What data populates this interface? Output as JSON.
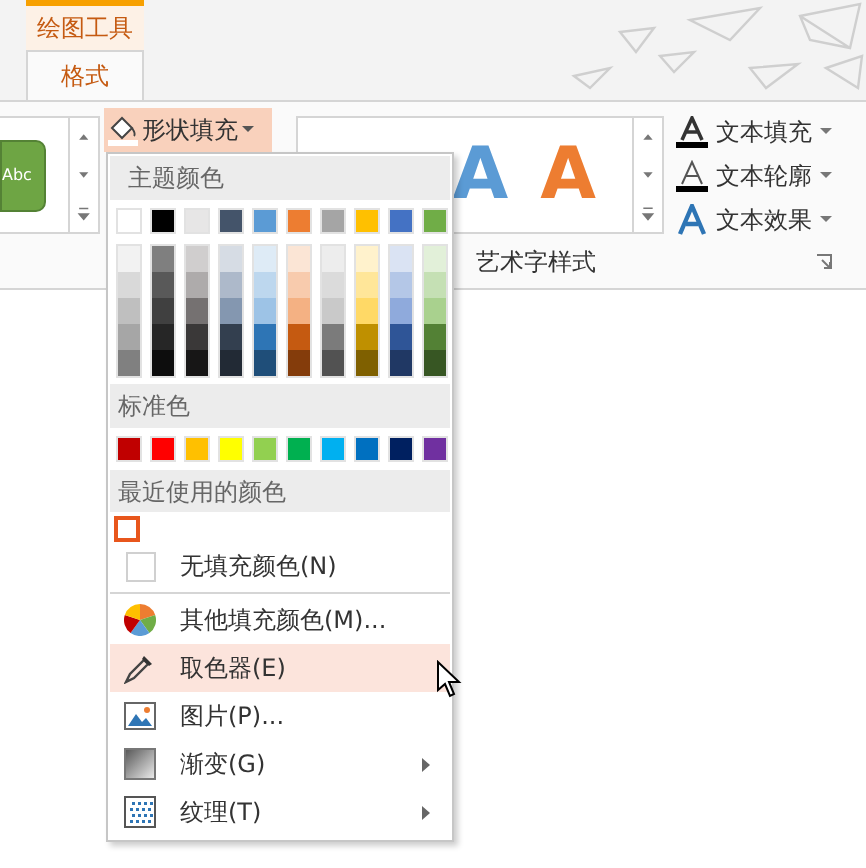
{
  "context_tab": {
    "label": "绘图工具"
  },
  "tabs": [
    {
      "label": "格式",
      "selected": true
    }
  ],
  "ribbon": {
    "shape_gallery": {
      "sample": "Abc"
    },
    "fill_button": {
      "label": "形状填充",
      "expanded": true
    },
    "wordart_gallery": {
      "samples": [
        {
          "text": "A",
          "color": "#5b9bd5"
        },
        {
          "text": "A",
          "color": "#ed7d31"
        }
      ]
    },
    "text_buttons": [
      {
        "kind": "fill",
        "label": "文本填充"
      },
      {
        "kind": "outline",
        "label": "文本轮廓"
      },
      {
        "kind": "effect",
        "label": "文本效果"
      }
    ],
    "group_label": "艺术字样式"
  },
  "menu": {
    "theme_header": "主题颜色",
    "theme_colors": [
      {
        "color": "#ffffff"
      },
      {
        "color": "#000000"
      },
      {
        "color": "#e7e6e6"
      },
      {
        "color": "#44546a"
      },
      {
        "color": "#5b9bd5"
      },
      {
        "color": "#ed7d31"
      },
      {
        "color": "#a5a5a5"
      },
      {
        "color": "#ffc000"
      },
      {
        "color": "#4472c4"
      },
      {
        "color": "#70ad47"
      }
    ],
    "shade_columns": [
      {
        "shades": [
          {
            "color": "#f2f2f2"
          },
          {
            "color": "#d9d9d9"
          },
          {
            "color": "#bfbfbf"
          },
          {
            "color": "#a6a6a6"
          },
          {
            "color": "#808080"
          }
        ]
      },
      {
        "shades": [
          {
            "color": "#7f7f7f"
          },
          {
            "color": "#595959"
          },
          {
            "color": "#404040"
          },
          {
            "color": "#262626"
          },
          {
            "color": "#0d0d0d"
          }
        ]
      },
      {
        "shades": [
          {
            "color": "#d0cece"
          },
          {
            "color": "#aeabab"
          },
          {
            "color": "#757171"
          },
          {
            "color": "#3a3838"
          },
          {
            "color": "#171616"
          }
        ]
      },
      {
        "shades": [
          {
            "color": "#d6dce4"
          },
          {
            "color": "#adb9ca"
          },
          {
            "color": "#8497b0"
          },
          {
            "color": "#333f4f"
          },
          {
            "color": "#222a35"
          }
        ]
      },
      {
        "shades": [
          {
            "color": "#deebf6"
          },
          {
            "color": "#bdd7ee"
          },
          {
            "color": "#9dc3e6"
          },
          {
            "color": "#2e75b5"
          },
          {
            "color": "#1f4e79"
          }
        ]
      },
      {
        "shades": [
          {
            "color": "#fbe5d5"
          },
          {
            "color": "#f8cbad"
          },
          {
            "color": "#f4b183"
          },
          {
            "color": "#c55a11"
          },
          {
            "color": "#843c0b"
          }
        ]
      },
      {
        "shades": [
          {
            "color": "#ededed"
          },
          {
            "color": "#dbdbdb"
          },
          {
            "color": "#c9c9c9"
          },
          {
            "color": "#7b7b7b"
          },
          {
            "color": "#525252"
          }
        ]
      },
      {
        "shades": [
          {
            "color": "#fff2cc"
          },
          {
            "color": "#ffe699"
          },
          {
            "color": "#ffd966"
          },
          {
            "color": "#bf9000"
          },
          {
            "color": "#7f6000"
          }
        ]
      },
      {
        "shades": [
          {
            "color": "#dae3f3"
          },
          {
            "color": "#b4c7e7"
          },
          {
            "color": "#8faadc"
          },
          {
            "color": "#2f5597"
          },
          {
            "color": "#203864"
          }
        ]
      },
      {
        "shades": [
          {
            "color": "#e2f0d9"
          },
          {
            "color": "#c5e0b4"
          },
          {
            "color": "#a9d18e"
          },
          {
            "color": "#538135"
          },
          {
            "color": "#375623"
          }
        ]
      }
    ],
    "standard_header": "标准色",
    "standard_colors": [
      {
        "color": "#c00000"
      },
      {
        "color": "#ff0000"
      },
      {
        "color": "#ffc000"
      },
      {
        "color": "#ffff00"
      },
      {
        "color": "#92d050"
      },
      {
        "color": "#00b050"
      },
      {
        "color": "#00b0f0"
      },
      {
        "color": "#0070c0"
      },
      {
        "color": "#002060"
      },
      {
        "color": "#7030a0"
      }
    ],
    "recent_header": "最近使用的颜色",
    "recent_colors": [
      {
        "selected": true
      }
    ],
    "items": [
      {
        "kind": "no-fill",
        "label": "无填充颜色(N)",
        "selected": false,
        "submenu": false
      },
      {
        "kind": "more-colors",
        "label": "其他填充颜色(M)...",
        "selected": false,
        "submenu": false
      },
      {
        "kind": "eyedropper",
        "label": "取色器(E)",
        "selected": true,
        "submenu": false
      },
      {
        "kind": "picture",
        "label": "图片(P)...",
        "selected": false,
        "submenu": false
      },
      {
        "kind": "gradient",
        "label": "渐变(G)",
        "selected": false,
        "submenu": true
      },
      {
        "kind": "texture",
        "label": "纹理(T)",
        "selected": false,
        "submenu": true
      }
    ]
  }
}
